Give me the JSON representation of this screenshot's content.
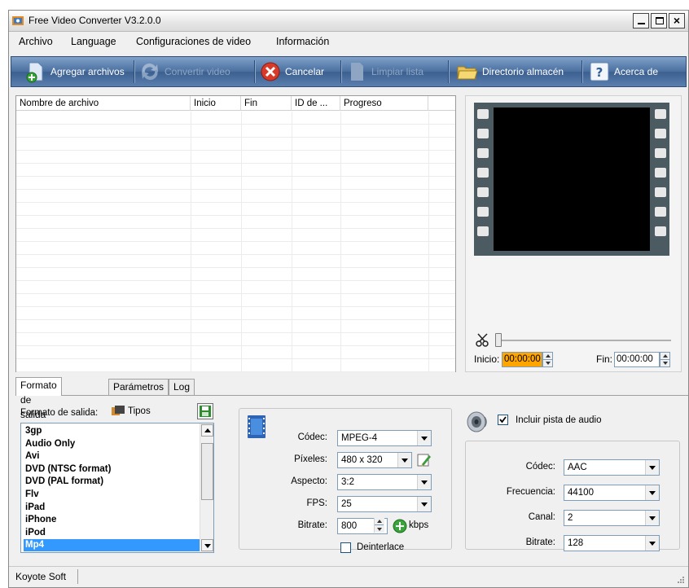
{
  "window": {
    "title": "Free Video Converter V3.2.0.0"
  },
  "menu": [
    "Archivo",
    "Language",
    "Configuraciones de video",
    "Información"
  ],
  "toolbar": {
    "add_files": "Agregar archivos",
    "convert": "Convertir video",
    "cancel": "Cancelar",
    "clear": "Limpiar lista",
    "storage_dir": "Directorio almacén",
    "about": "Acerca de"
  },
  "filelist": {
    "columns": [
      "Nombre de archivo",
      "Inicio",
      "Fin",
      "ID de ...",
      "Progreso"
    ]
  },
  "preview": {
    "start_label": "Inicio:",
    "start_time": "00:00:00",
    "end_label": "Fin:",
    "end_time": "00:00:00"
  },
  "tabs": [
    "Formato de salida",
    "Parámetros",
    "Log"
  ],
  "output": {
    "label": "Formato de salida:",
    "types_button": "Tipos",
    "formats": [
      "3gp",
      "Audio Only",
      "Avi",
      "DVD (NTSC format)",
      "DVD (PAL format)",
      "Flv",
      "iPad",
      "iPhone",
      "iPod",
      "Mp4"
    ],
    "selected": "Mp4"
  },
  "video": {
    "codec_label": "Códec:",
    "codec": "MPEG-4",
    "pixels_label": "Píxeles:",
    "pixels": "480 x 320",
    "aspect_label": "Aspecto:",
    "aspect": "3:2",
    "fps_label": "FPS:",
    "fps": "25",
    "bitrate_label": "Bitrate:",
    "bitrate": "800",
    "bitrate_unit": "kbps",
    "deinterlace_label": "Deinterlace"
  },
  "audio": {
    "include_label": "Incluir pista de audio",
    "codec_label": "Códec:",
    "codec": "AAC",
    "frequency_label": "Frecuencia:",
    "frequency": "44100",
    "channel_label": "Canal:",
    "channel": "2",
    "bitrate_label": "Bitrate:",
    "bitrate": "128"
  },
  "status": {
    "text": "Koyote Soft"
  }
}
